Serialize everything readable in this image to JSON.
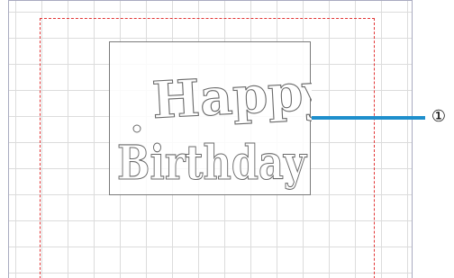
{
  "design": {
    "line1": "Happy",
    "line2": "Birthday"
  },
  "callout": {
    "label": "①"
  },
  "colors": {
    "cut_area_border": "#e23636",
    "callout_line": "#1f8fcc",
    "grid": "#dcdcdc",
    "mat_border": "#a9abc0"
  }
}
